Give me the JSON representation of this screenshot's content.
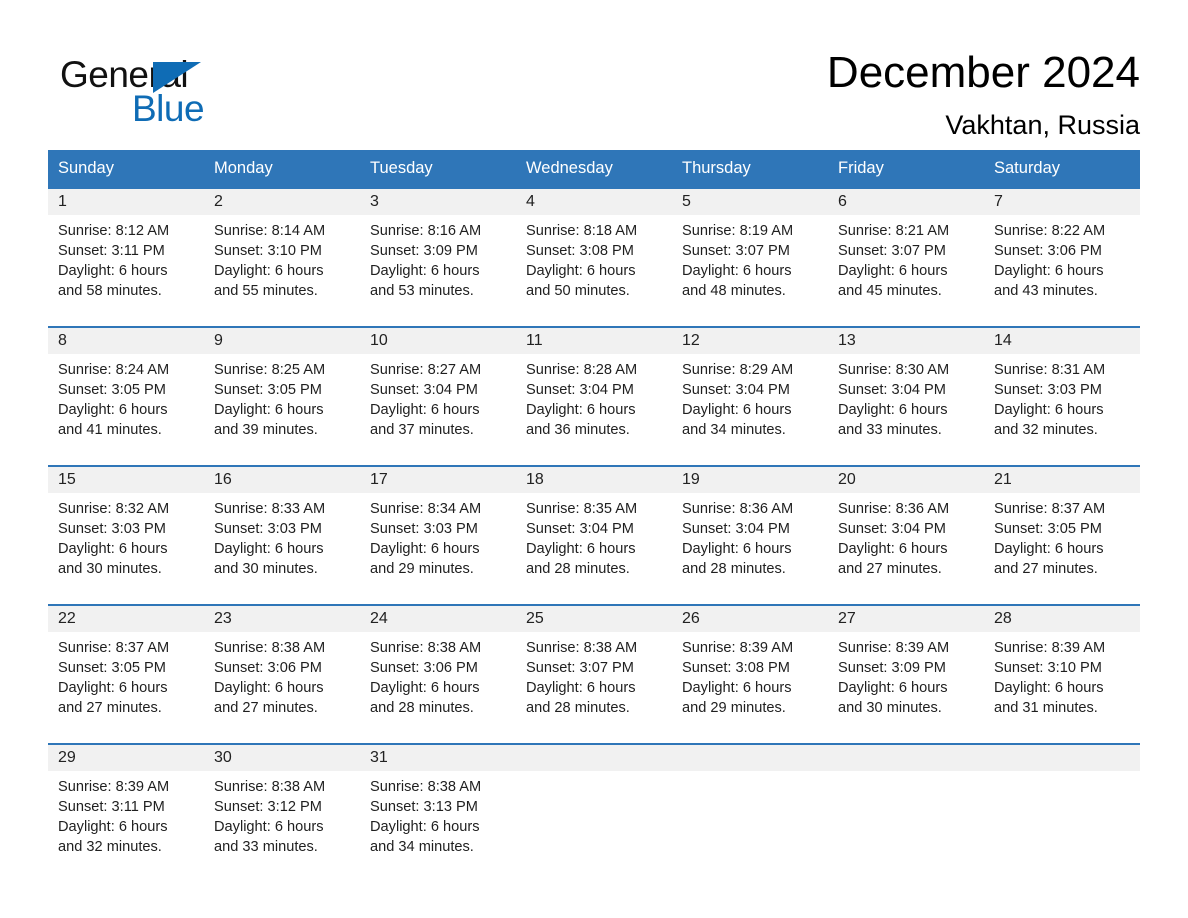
{
  "brand": {
    "name_part1": "General",
    "name_part2": "Blue",
    "accent_color": "#0f6cb5"
  },
  "header": {
    "title": "December 2024",
    "location": "Vakhtan, Russia"
  },
  "calendar": {
    "header_bg": "#2f76b8",
    "daynum_bg": "#f1f1f1",
    "weekdays": [
      "Sunday",
      "Monday",
      "Tuesday",
      "Wednesday",
      "Thursday",
      "Friday",
      "Saturday"
    ],
    "weeks": [
      [
        {
          "day": "1",
          "sunrise": "Sunrise: 8:12 AM",
          "sunset": "Sunset: 3:11 PM",
          "daylight_line1": "Daylight: 6 hours",
          "daylight_line2": "and 58 minutes."
        },
        {
          "day": "2",
          "sunrise": "Sunrise: 8:14 AM",
          "sunset": "Sunset: 3:10 PM",
          "daylight_line1": "Daylight: 6 hours",
          "daylight_line2": "and 55 minutes."
        },
        {
          "day": "3",
          "sunrise": "Sunrise: 8:16 AM",
          "sunset": "Sunset: 3:09 PM",
          "daylight_line1": "Daylight: 6 hours",
          "daylight_line2": "and 53 minutes."
        },
        {
          "day": "4",
          "sunrise": "Sunrise: 8:18 AM",
          "sunset": "Sunset: 3:08 PM",
          "daylight_line1": "Daylight: 6 hours",
          "daylight_line2": "and 50 minutes."
        },
        {
          "day": "5",
          "sunrise": "Sunrise: 8:19 AM",
          "sunset": "Sunset: 3:07 PM",
          "daylight_line1": "Daylight: 6 hours",
          "daylight_line2": "and 48 minutes."
        },
        {
          "day": "6",
          "sunrise": "Sunrise: 8:21 AM",
          "sunset": "Sunset: 3:07 PM",
          "daylight_line1": "Daylight: 6 hours",
          "daylight_line2": "and 45 minutes."
        },
        {
          "day": "7",
          "sunrise": "Sunrise: 8:22 AM",
          "sunset": "Sunset: 3:06 PM",
          "daylight_line1": "Daylight: 6 hours",
          "daylight_line2": "and 43 minutes."
        }
      ],
      [
        {
          "day": "8",
          "sunrise": "Sunrise: 8:24 AM",
          "sunset": "Sunset: 3:05 PM",
          "daylight_line1": "Daylight: 6 hours",
          "daylight_line2": "and 41 minutes."
        },
        {
          "day": "9",
          "sunrise": "Sunrise: 8:25 AM",
          "sunset": "Sunset: 3:05 PM",
          "daylight_line1": "Daylight: 6 hours",
          "daylight_line2": "and 39 minutes."
        },
        {
          "day": "10",
          "sunrise": "Sunrise: 8:27 AM",
          "sunset": "Sunset: 3:04 PM",
          "daylight_line1": "Daylight: 6 hours",
          "daylight_line2": "and 37 minutes."
        },
        {
          "day": "11",
          "sunrise": "Sunrise: 8:28 AM",
          "sunset": "Sunset: 3:04 PM",
          "daylight_line1": "Daylight: 6 hours",
          "daylight_line2": "and 36 minutes."
        },
        {
          "day": "12",
          "sunrise": "Sunrise: 8:29 AM",
          "sunset": "Sunset: 3:04 PM",
          "daylight_line1": "Daylight: 6 hours",
          "daylight_line2": "and 34 minutes."
        },
        {
          "day": "13",
          "sunrise": "Sunrise: 8:30 AM",
          "sunset": "Sunset: 3:04 PM",
          "daylight_line1": "Daylight: 6 hours",
          "daylight_line2": "and 33 minutes."
        },
        {
          "day": "14",
          "sunrise": "Sunrise: 8:31 AM",
          "sunset": "Sunset: 3:03 PM",
          "daylight_line1": "Daylight: 6 hours",
          "daylight_line2": "and 32 minutes."
        }
      ],
      [
        {
          "day": "15",
          "sunrise": "Sunrise: 8:32 AM",
          "sunset": "Sunset: 3:03 PM",
          "daylight_line1": "Daylight: 6 hours",
          "daylight_line2": "and 30 minutes."
        },
        {
          "day": "16",
          "sunrise": "Sunrise: 8:33 AM",
          "sunset": "Sunset: 3:03 PM",
          "daylight_line1": "Daylight: 6 hours",
          "daylight_line2": "and 30 minutes."
        },
        {
          "day": "17",
          "sunrise": "Sunrise: 8:34 AM",
          "sunset": "Sunset: 3:03 PM",
          "daylight_line1": "Daylight: 6 hours",
          "daylight_line2": "and 29 minutes."
        },
        {
          "day": "18",
          "sunrise": "Sunrise: 8:35 AM",
          "sunset": "Sunset: 3:04 PM",
          "daylight_line1": "Daylight: 6 hours",
          "daylight_line2": "and 28 minutes."
        },
        {
          "day": "19",
          "sunrise": "Sunrise: 8:36 AM",
          "sunset": "Sunset: 3:04 PM",
          "daylight_line1": "Daylight: 6 hours",
          "daylight_line2": "and 28 minutes."
        },
        {
          "day": "20",
          "sunrise": "Sunrise: 8:36 AM",
          "sunset": "Sunset: 3:04 PM",
          "daylight_line1": "Daylight: 6 hours",
          "daylight_line2": "and 27 minutes."
        },
        {
          "day": "21",
          "sunrise": "Sunrise: 8:37 AM",
          "sunset": "Sunset: 3:05 PM",
          "daylight_line1": "Daylight: 6 hours",
          "daylight_line2": "and 27 minutes."
        }
      ],
      [
        {
          "day": "22",
          "sunrise": "Sunrise: 8:37 AM",
          "sunset": "Sunset: 3:05 PM",
          "daylight_line1": "Daylight: 6 hours",
          "daylight_line2": "and 27 minutes."
        },
        {
          "day": "23",
          "sunrise": "Sunrise: 8:38 AM",
          "sunset": "Sunset: 3:06 PM",
          "daylight_line1": "Daylight: 6 hours",
          "daylight_line2": "and 27 minutes."
        },
        {
          "day": "24",
          "sunrise": "Sunrise: 8:38 AM",
          "sunset": "Sunset: 3:06 PM",
          "daylight_line1": "Daylight: 6 hours",
          "daylight_line2": "and 28 minutes."
        },
        {
          "day": "25",
          "sunrise": "Sunrise: 8:38 AM",
          "sunset": "Sunset: 3:07 PM",
          "daylight_line1": "Daylight: 6 hours",
          "daylight_line2": "and 28 minutes."
        },
        {
          "day": "26",
          "sunrise": "Sunrise: 8:39 AM",
          "sunset": "Sunset: 3:08 PM",
          "daylight_line1": "Daylight: 6 hours",
          "daylight_line2": "and 29 minutes."
        },
        {
          "day": "27",
          "sunrise": "Sunrise: 8:39 AM",
          "sunset": "Sunset: 3:09 PM",
          "daylight_line1": "Daylight: 6 hours",
          "daylight_line2": "and 30 minutes."
        },
        {
          "day": "28",
          "sunrise": "Sunrise: 8:39 AM",
          "sunset": "Sunset: 3:10 PM",
          "daylight_line1": "Daylight: 6 hours",
          "daylight_line2": "and 31 minutes."
        }
      ],
      [
        {
          "day": "29",
          "sunrise": "Sunrise: 8:39 AM",
          "sunset": "Sunset: 3:11 PM",
          "daylight_line1": "Daylight: 6 hours",
          "daylight_line2": "and 32 minutes."
        },
        {
          "day": "30",
          "sunrise": "Sunrise: 8:38 AM",
          "sunset": "Sunset: 3:12 PM",
          "daylight_line1": "Daylight: 6 hours",
          "daylight_line2": "and 33 minutes."
        },
        {
          "day": "31",
          "sunrise": "Sunrise: 8:38 AM",
          "sunset": "Sunset: 3:13 PM",
          "daylight_line1": "Daylight: 6 hours",
          "daylight_line2": "and 34 minutes."
        },
        {
          "day": "",
          "sunrise": "",
          "sunset": "",
          "daylight_line1": "",
          "daylight_line2": ""
        },
        {
          "day": "",
          "sunrise": "",
          "sunset": "",
          "daylight_line1": "",
          "daylight_line2": ""
        },
        {
          "day": "",
          "sunrise": "",
          "sunset": "",
          "daylight_line1": "",
          "daylight_line2": ""
        },
        {
          "day": "",
          "sunrise": "",
          "sunset": "",
          "daylight_line1": "",
          "daylight_line2": ""
        }
      ]
    ]
  }
}
